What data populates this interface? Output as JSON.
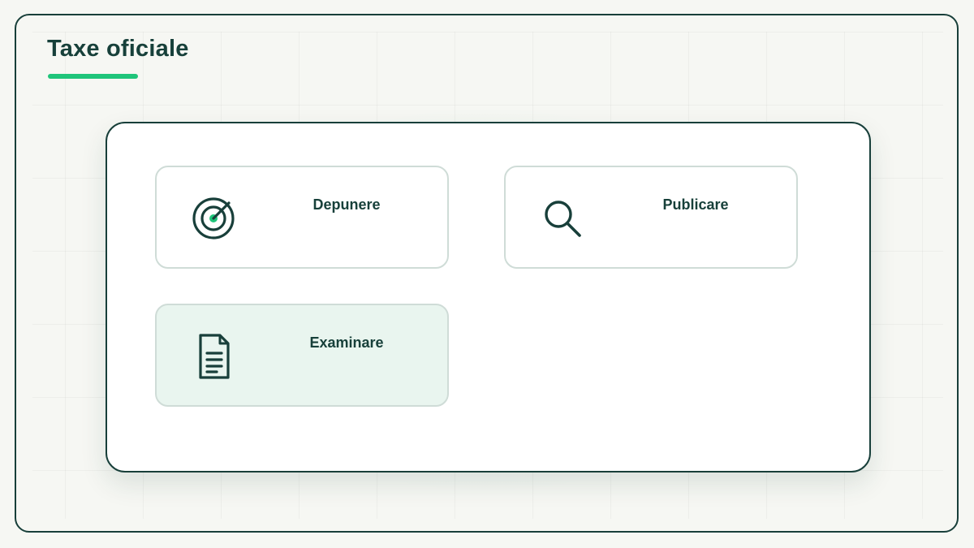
{
  "page": {
    "title": "Taxe oficiale"
  },
  "colors": {
    "primary": "#183f3a",
    "accent": "#1fc57a",
    "card_border": "#cfdcd7",
    "card_active_bg": "#e9f5ef",
    "background": "#f6f7f3"
  },
  "cards": [
    {
      "label": "Depunere",
      "icon": "target-icon",
      "active": false
    },
    {
      "label": "Publicare",
      "icon": "search-icon",
      "active": false
    },
    {
      "label": "Examinare",
      "icon": "document-icon",
      "active": true
    }
  ]
}
